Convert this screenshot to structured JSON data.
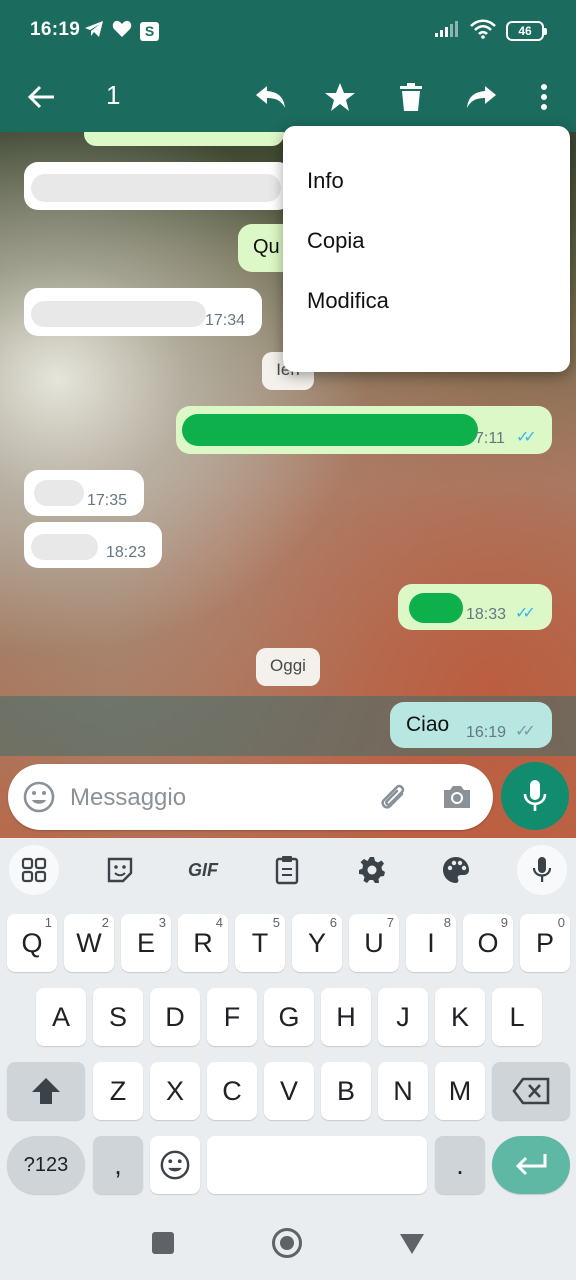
{
  "status_bar": {
    "time": "16:19",
    "battery": "46"
  },
  "app_bar": {
    "selected_count": "1"
  },
  "menu": {
    "items": [
      {
        "label": "Info"
      },
      {
        "label": "Copia"
      },
      {
        "label": "Modifica"
      }
    ]
  },
  "chat": {
    "partial_text_1": "Qu",
    "partial_text_2": "Ieri",
    "date_chip": "Oggi",
    "times": {
      "in_1": "17:34",
      "out_1": "7:11",
      "in_2": "17:35",
      "in_3": "18:23",
      "out_2": "18:33",
      "selected": "16:19"
    },
    "selected_message": "Ciao"
  },
  "composer": {
    "placeholder": "Messaggio"
  },
  "keyboard": {
    "gif_label": "GIF",
    "row1": [
      {
        "key": "Q",
        "hint": "1"
      },
      {
        "key": "W",
        "hint": "2"
      },
      {
        "key": "E",
        "hint": "3"
      },
      {
        "key": "R",
        "hint": "4"
      },
      {
        "key": "T",
        "hint": "5"
      },
      {
        "key": "Y",
        "hint": "6"
      },
      {
        "key": "U",
        "hint": "7"
      },
      {
        "key": "I",
        "hint": "8"
      },
      {
        "key": "O",
        "hint": "9"
      },
      {
        "key": "P",
        "hint": "0"
      }
    ],
    "row2": [
      "A",
      "S",
      "D",
      "F",
      "G",
      "H",
      "J",
      "K",
      "L"
    ],
    "row3": [
      "Z",
      "X",
      "C",
      "V",
      "B",
      "N",
      "M"
    ],
    "symbols_label": "?123",
    "comma": ",",
    "period": "."
  },
  "colors": {
    "header": "#1b6b5e",
    "fab": "#128c6e",
    "outgoing_bubble": "#dcf8c6",
    "selected_bubble": "#b8e6e0",
    "read_ticks": "#34b7f1"
  }
}
